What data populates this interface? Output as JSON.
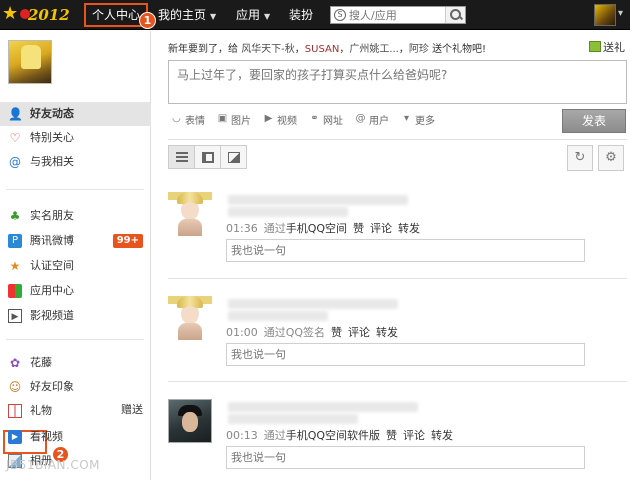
{
  "logo": {
    "text": "2012"
  },
  "topnav": {
    "items": [
      {
        "label": "个人中心",
        "badge": "1"
      },
      {
        "label": "我的主页"
      },
      {
        "label": "应用"
      },
      {
        "label": "装扮"
      }
    ],
    "search_placeholder": "搜人/应用"
  },
  "sidebar": {
    "items": [
      {
        "label": "好友动态",
        "icon": "person-icon",
        "active": true
      },
      {
        "label": "特别关心",
        "icon": "heart-icon"
      },
      {
        "label": "与我相关",
        "icon": "at-icon"
      },
      {
        "label": "实名朋友",
        "icon": "clover-icon"
      },
      {
        "label": "腾讯微博",
        "icon": "weibo-icon",
        "badge": "99+"
      },
      {
        "label": "认证空间",
        "icon": "star-icon"
      },
      {
        "label": "应用中心",
        "icon": "apps-icon"
      },
      {
        "label": "影视频道",
        "icon": "film-icon"
      },
      {
        "label": "花藤",
        "icon": "flower-icon"
      },
      {
        "label": "好友印象",
        "icon": "face-icon"
      },
      {
        "label": "礼物",
        "icon": "gift-icon",
        "extra": "赠送",
        "badge": "2"
      },
      {
        "label": "看视频",
        "icon": "play-icon"
      },
      {
        "label": "相册",
        "icon": "album-icon"
      }
    ],
    "watermark": "JB51BIAN.COM"
  },
  "greeting": {
    "prefix": "新年要到了，给",
    "friends": [
      "风华天下-秋",
      "SUSAN",
      "广州姚工...",
      "阿珍"
    ],
    "suffix": "送个礼物吧!",
    "send_gift": "送礼"
  },
  "composer": {
    "placeholder": "马上过年了，要回家的孩子打算买点什么给爸妈呢?",
    "tools": [
      "表情",
      "图片",
      "视频",
      "网址",
      "用户",
      "更多"
    ],
    "post_button": "发表"
  },
  "feed": [
    {
      "time": "01:36",
      "via": "通过",
      "client": "手机QQ空间",
      "actions": [
        "赞",
        "评论",
        "转发"
      ],
      "reply_placeholder": "我也说一句"
    },
    {
      "time": "01:00",
      "via": "通过QQ签名",
      "client": "",
      "actions": [
        "赞",
        "评论",
        "转发"
      ],
      "reply_placeholder": "我也说一句"
    },
    {
      "time": "00:13",
      "via": "通过",
      "client": "手机QQ空间软件版",
      "actions": [
        "赞",
        "评论",
        "转发"
      ],
      "reply_placeholder": "我也说一句"
    }
  ],
  "colors": {
    "accent": "#e8541e",
    "topbar": "#1a1a1a",
    "gold": "#f5c400"
  }
}
